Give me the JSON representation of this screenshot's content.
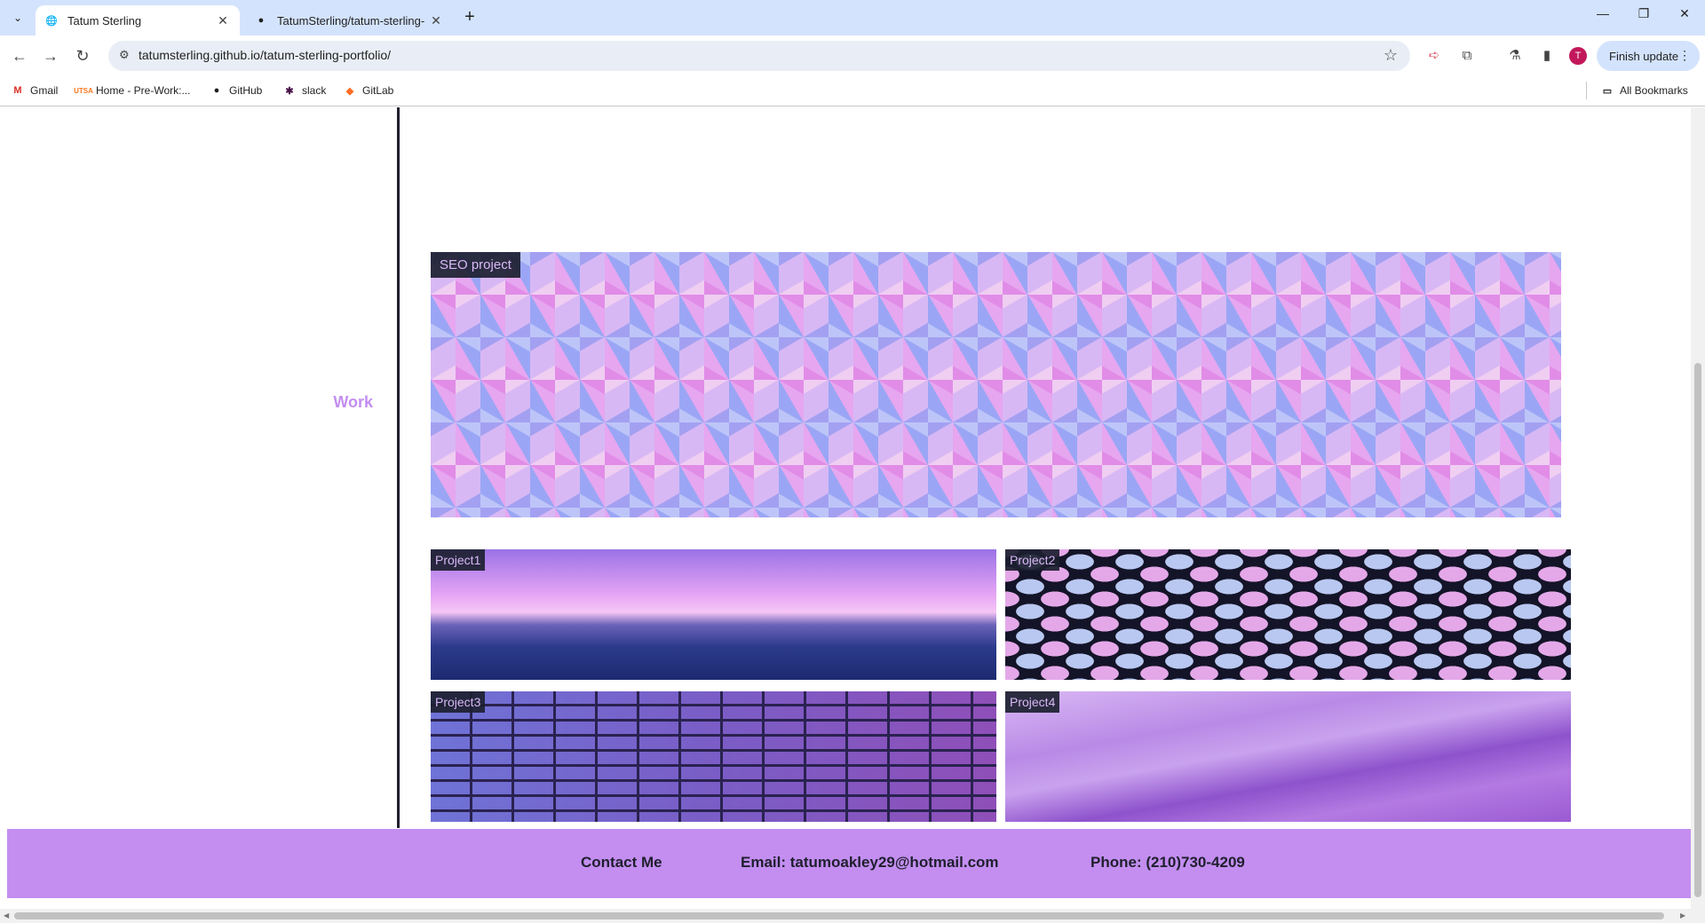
{
  "browser": {
    "tabs": [
      {
        "title": "Tatum Sterling",
        "active": true,
        "icon": "globe-icon"
      },
      {
        "title": "TatumSterling/tatum-sterling-",
        "active": false,
        "icon": "github-icon"
      }
    ],
    "url": "tatumsterling.github.io/tatum-sterling-portfolio/",
    "profile_initial": "T",
    "update_label": "Finish update",
    "bookmarks": [
      {
        "label": "Gmail",
        "icon": "gmail-icon"
      },
      {
        "label": "Home - Pre-Work:...",
        "icon": "utsa-icon"
      },
      {
        "label": "GitHub",
        "icon": "github-icon"
      },
      {
        "label": "slack",
        "icon": "slack-icon"
      },
      {
        "label": "GitLab",
        "icon": "gitlab-icon"
      }
    ],
    "all_bookmarks_label": "All Bookmarks"
  },
  "page": {
    "section_label": "Work",
    "featured_project": {
      "caption": "SEO project"
    },
    "projects": [
      {
        "caption": "Project1"
      },
      {
        "caption": "Project2"
      },
      {
        "caption": "Project3"
      },
      {
        "caption": "Project4"
      }
    ],
    "footer": {
      "contact": "Contact Me",
      "email": "Email: tatumoakley29@hotmail.com",
      "phone": "Phone: (210)730-4209"
    },
    "colors": {
      "accent": "#c38ef0",
      "rule": "#1f1f2e",
      "caption_bg": "#1c2030",
      "caption_text": "#d9b8f7"
    }
  }
}
